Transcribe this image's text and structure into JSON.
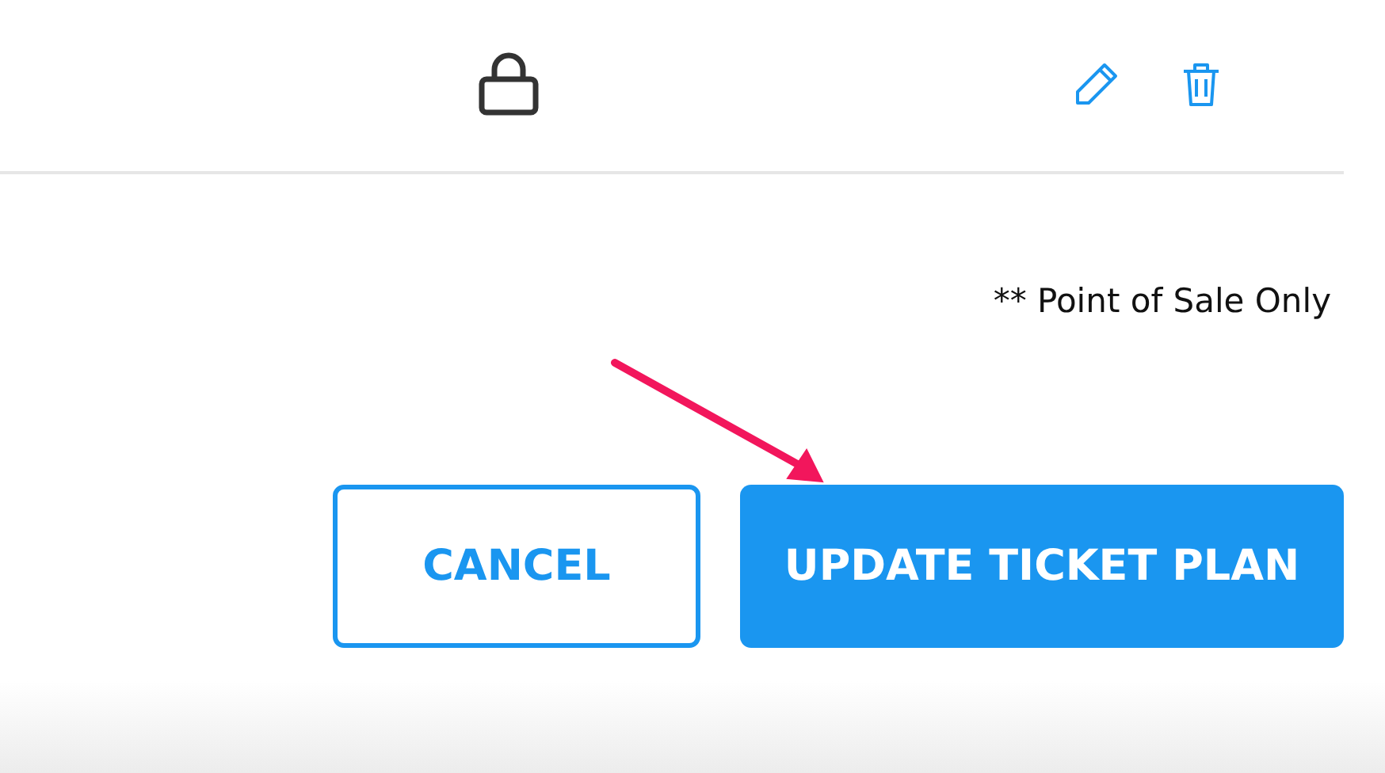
{
  "note": "** Point of Sale Only",
  "buttons": [
    {
      "label": "CANCEL",
      "kind": "secondary"
    },
    {
      "label": "UPDATE TICKET PLAN",
      "kind": "primary"
    }
  ]
}
